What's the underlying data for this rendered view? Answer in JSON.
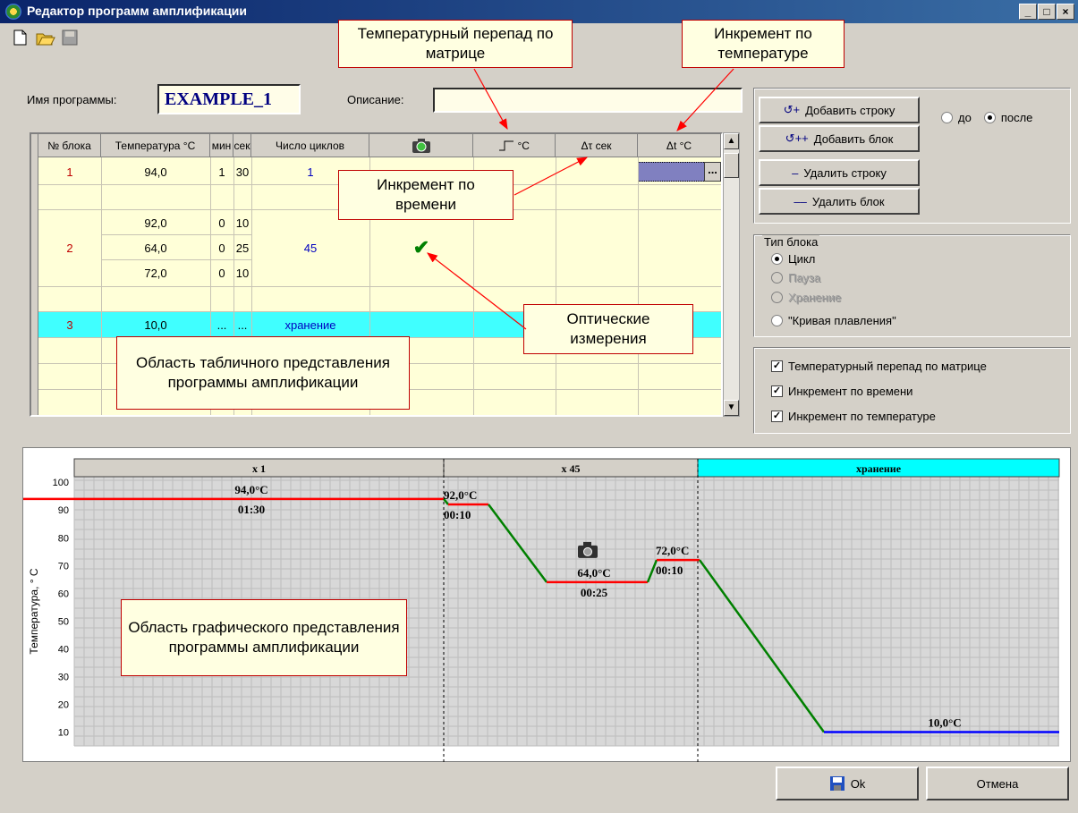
{
  "window": {
    "title": "Редактор программ амплификации"
  },
  "toolbar": {
    "new": "new-doc-icon",
    "open": "open-folder-icon",
    "save": "save-disabled-icon"
  },
  "program": {
    "name_label": "Имя программы:",
    "name_value": "EXAMPLE_1",
    "desc_label": "Описание:",
    "desc_value": ""
  },
  "table": {
    "headers": [
      "№ блока",
      "Температура °C",
      "мин",
      "сек",
      "Число циклов",
      "camera-icon",
      "°C",
      "Δτ сек",
      "Δt °C"
    ],
    "rows": [
      {
        "block": "1",
        "temp": "94,0",
        "min": "1",
        "sec": "30",
        "cycles": "1"
      },
      {
        "block": "",
        "temp": "",
        "min": "",
        "sec": "",
        "cycles": ""
      },
      {
        "block": "",
        "temp": "92,0",
        "min": "0",
        "sec": "10",
        "cycles": ""
      },
      {
        "block": "2",
        "temp": "64,0",
        "min": "0",
        "sec": "25",
        "cycles": "45",
        "optical": "✔"
      },
      {
        "block": "",
        "temp": "72,0",
        "min": "0",
        "sec": "10",
        "cycles": ""
      },
      {
        "block": "",
        "temp": "",
        "min": "",
        "sec": "",
        "cycles": ""
      },
      {
        "block": "3",
        "temp": "10,0",
        "min": "...",
        "sec": "...",
        "cycles": "хранение"
      }
    ],
    "ellipsis": "..."
  },
  "buttons": {
    "add_row": "Добавить строку",
    "add_block": "Добавить блок",
    "del_row": "Удалить строку",
    "del_block": "Удалить блок",
    "ok": "Ok",
    "cancel": "Отмена"
  },
  "position": {
    "before": "до",
    "after": "после",
    "selected": "после"
  },
  "block_type": {
    "title": "Тип блока",
    "options": [
      "Цикл",
      "Пауза",
      "Хранение",
      "\"Кривая плавления\""
    ],
    "selected": "Цикл"
  },
  "options": {
    "items": [
      "Температурный перепад по матрице",
      "Инкремент по времени",
      "Инкремент по температуре"
    ]
  },
  "callouts": {
    "matrix": "Температурный перепад по матрице",
    "temp_incr": "Инкремент по температуре",
    "time_incr": "Инкремент по времени",
    "optical": "Оптические измерения",
    "table_area": "Область табличного представления программы амплификации",
    "graph_area": "Область графического представления программы амплификации"
  },
  "chart_data": {
    "type": "line",
    "ylabel": "Температура, ° С",
    "yticks": [
      10,
      20,
      30,
      40,
      50,
      60,
      70,
      80,
      90,
      100
    ],
    "sections": [
      "x 1",
      "x 45",
      "хранение"
    ],
    "labels": [
      {
        "temp": "94,0°C",
        "time": "01:30"
      },
      {
        "temp": "92,0°C",
        "time": "00:10"
      },
      {
        "temp": "64,0°C",
        "time": "00:25"
      },
      {
        "temp": "72,0°C",
        "time": "00:10"
      },
      {
        "temp": "10,0°C",
        "time": ""
      }
    ],
    "steps": [
      94,
      92,
      64,
      72,
      10
    ],
    "colors": {
      "hold": "#ff0000",
      "ramp": "#008000",
      "storage": "#0000ff",
      "storage_header": "#00ffff"
    }
  }
}
